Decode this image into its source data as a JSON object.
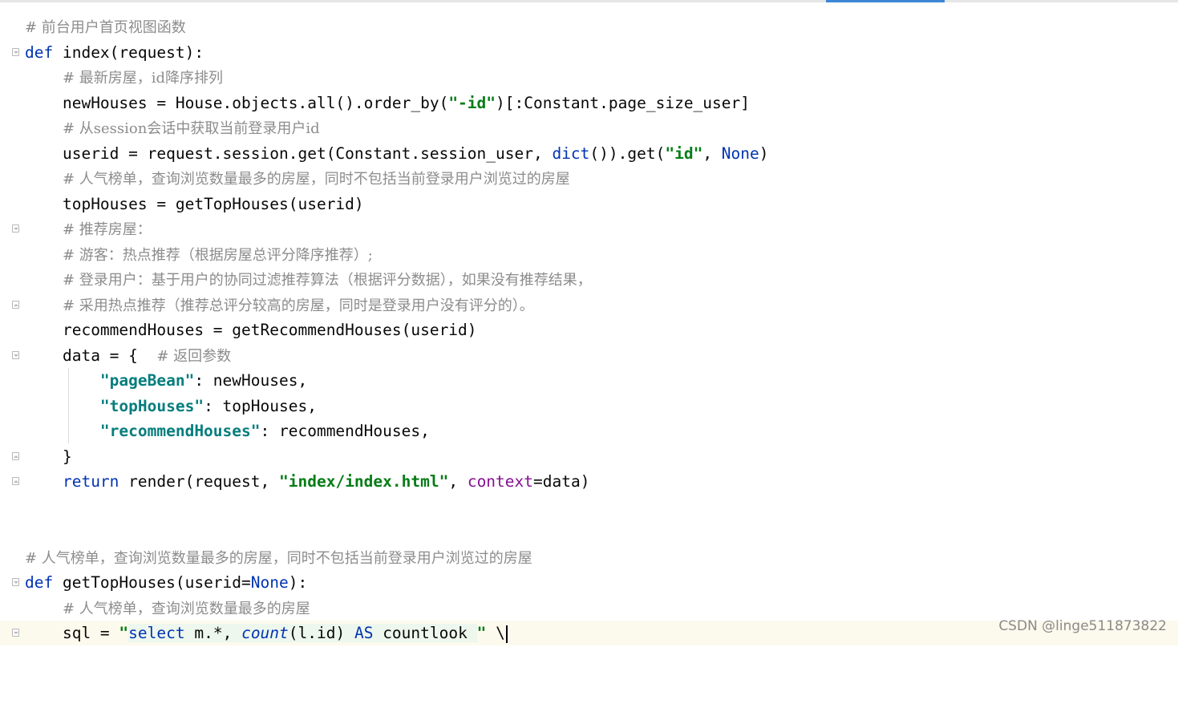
{
  "code": {
    "l1_comment": "# 前台用户首页视图函数",
    "l2_def": "def",
    "l2_rest": " index(request):",
    "l3_comment": "# 最新房屋，id降序排列",
    "l4_a": "newHouses = House.objects.all().order_by(",
    "l4_str": "\"-id\"",
    "l4_b": ")[:Constant.page_size_user]",
    "l5_comment": "# 从session会话中获取当前登录用户id",
    "l6_a": "userid = request.session.get(Constant.session_user, ",
    "l6_dict": "dict",
    "l6_b": "()).get(",
    "l6_str": "\"id\"",
    "l6_c": ", ",
    "l6_none": "None",
    "l6_d": ")",
    "l7_comment": "# 人气榜单，查询浏览数量最多的房屋，同时不包括当前登录用户浏览过的房屋",
    "l8": "topHouses = getTopHouses(userid)",
    "l9_comment": "# 推荐房屋：",
    "l10_comment": "# 游客：热点推荐（根据房屋总评分降序推荐）;",
    "l11_comment": "# 登录用户：基于用户的协同过滤推荐算法（根据评分数据），如果没有推荐结果，",
    "l12_comment": "# 采用热点推荐（推荐总评分较高的房屋，同时是登录用户没有评分的）。",
    "l13": "recommendHouses = getRecommendHouses(userid)",
    "l14_a": "data = {  ",
    "l14_comment": "# 返回参数",
    "l15_key": "\"pageBean\"",
    "l15_rest": ": newHouses,",
    "l16_key": "\"topHouses\"",
    "l16_rest": ": topHouses,",
    "l17_key": "\"recommendHouses\"",
    "l17_rest": ": recommendHouses,",
    "l18": "}",
    "l19_return": "return",
    "l19_a": " render(request, ",
    "l19_str": "\"index/index.html\"",
    "l19_b": ", ",
    "l19_kw": "context",
    "l19_c": "=data)",
    "l22_comment": "# 人气榜单，查询浏览数量最多的房屋，同时不包括当前登录用户浏览过的房屋",
    "l23_def": "def",
    "l23_a": " getTopHouses(userid=",
    "l23_none": "None",
    "l23_b": "):",
    "l24_comment": "# 人气榜单，查询浏览数量最多的房屋",
    "l25_a": "sql = ",
    "l25_q": "\"",
    "l25_sel": "select",
    "l25_b": " m.*, ",
    "l25_count": "count",
    "l25_c": "(l.id) ",
    "l25_as": "AS",
    "l25_d": " countlook ",
    "l25_q2": "\"",
    "l25_e": " \\"
  },
  "watermark": "CSDN @linge511873822"
}
